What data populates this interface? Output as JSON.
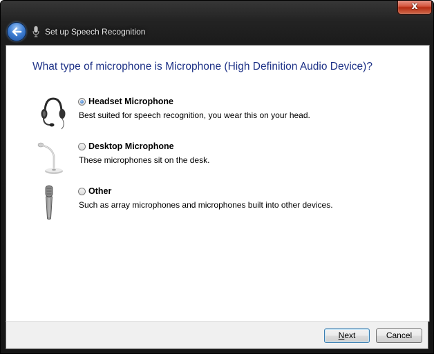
{
  "window": {
    "title": "Set up Speech Recognition",
    "close_symbol": "x"
  },
  "icons": {
    "back": "back-arrow-icon",
    "title": "microphone-icon",
    "close": "close-icon"
  },
  "question": "What type of microphone is Microphone (High Definition Audio Device)?",
  "options": [
    {
      "label": "Headset Microphone",
      "description": "Best suited for speech recognition, you wear this on your head.",
      "selected": true,
      "icon": "headset-microphone-icon"
    },
    {
      "label": "Desktop Microphone",
      "description": "These microphones sit on the desk.",
      "selected": false,
      "icon": "desktop-microphone-icon"
    },
    {
      "label": "Other",
      "description": "Such as array microphones and microphones built into other devices.",
      "selected": false,
      "icon": "handheld-microphone-icon"
    }
  ],
  "buttons": {
    "next_access_key": "N",
    "next_rest": "ext",
    "cancel": "Cancel"
  },
  "colors": {
    "question_text": "#1e3287",
    "chrome": "#1c1c1c",
    "close_button": "#c8442a"
  }
}
